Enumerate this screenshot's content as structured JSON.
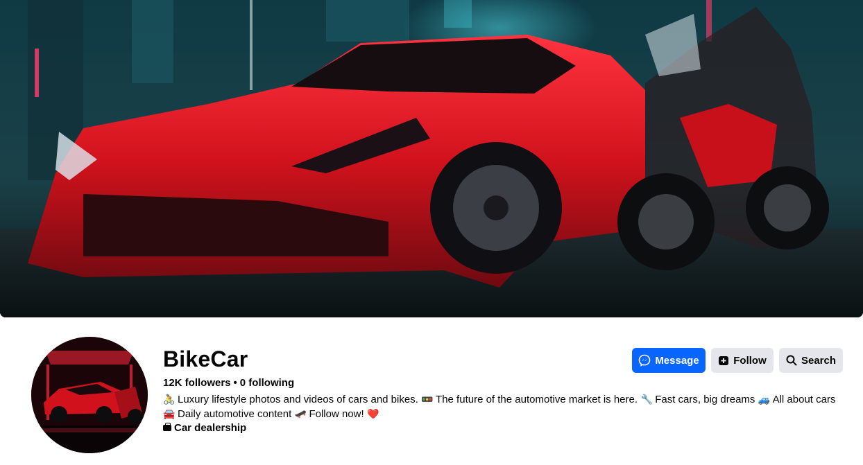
{
  "cover": {
    "image_alt": "cover-photo"
  },
  "profile": {
    "name": "BikeCar",
    "followers": "12K followers",
    "separator": "•",
    "following": "0 following",
    "bio_line1": [
      {
        "emoji": "🚴",
        "text": "Luxury lifestyle photos and videos of cars and bikes."
      },
      {
        "emoji": "🚥",
        "text": "The future of the automotive market is here."
      },
      {
        "emoji": "🔧",
        "text": "Fast cars, big dreams"
      },
      {
        "emoji": "🚙",
        "text": "All about cars"
      }
    ],
    "bio_line2": [
      {
        "emoji": "🚘",
        "text": "Daily automotive content"
      },
      {
        "emoji": "🛹",
        "text": "Follow now!"
      },
      {
        "emoji": "❤️",
        "text": ""
      }
    ],
    "category": "Car dealership"
  },
  "actions": {
    "message_label": "Message",
    "follow_label": "Follow",
    "search_label": "Search"
  },
  "colors": {
    "primary": "#0866ff",
    "secondary_btn": "#e4e6eb",
    "text": "#050505",
    "car_red": "#d1121c"
  }
}
